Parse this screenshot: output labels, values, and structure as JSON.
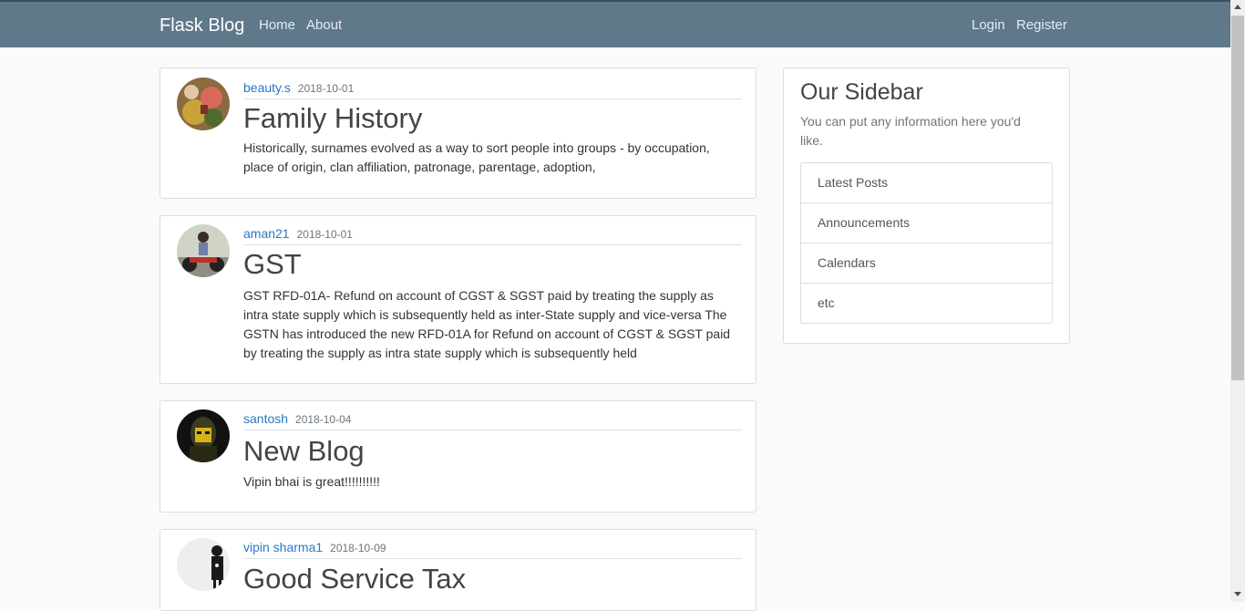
{
  "navbar": {
    "brand": "Flask Blog",
    "links": [
      "Home",
      "About"
    ],
    "auth_links": [
      "Login",
      "Register"
    ]
  },
  "posts": [
    {
      "author": "beauty.s",
      "date": "2018-10-01",
      "title": "Family History",
      "content": "Historically, surnames evolved as a way to sort people into groups - by occupation, place of origin, clan affiliation, patronage, parentage, adoption,"
    },
    {
      "author": "aman21",
      "date": "2018-10-01",
      "title": "GST",
      "content": "GST RFD-01A- Refund on account of CGST & SGST paid by treating the supply as intra state supply which is subsequently held as inter-State supply and vice-versa The GSTN has introduced the new RFD-01A for Refund on account of CGST & SGST paid by treating the supply as intra state supply which is subsequently held"
    },
    {
      "author": "santosh",
      "date": "2018-10-04",
      "title": "New Blog",
      "content": "Vipin bhai is great!!!!!!!!!!"
    },
    {
      "author": "vipin sharma1",
      "date": "2018-10-09",
      "title": "Good Service Tax",
      "content": ""
    }
  ],
  "sidebar": {
    "title": "Our Sidebar",
    "text": "You can put any information here you'd like.",
    "items": [
      "Latest Posts",
      "Announcements",
      "Calendars",
      "etc"
    ]
  }
}
